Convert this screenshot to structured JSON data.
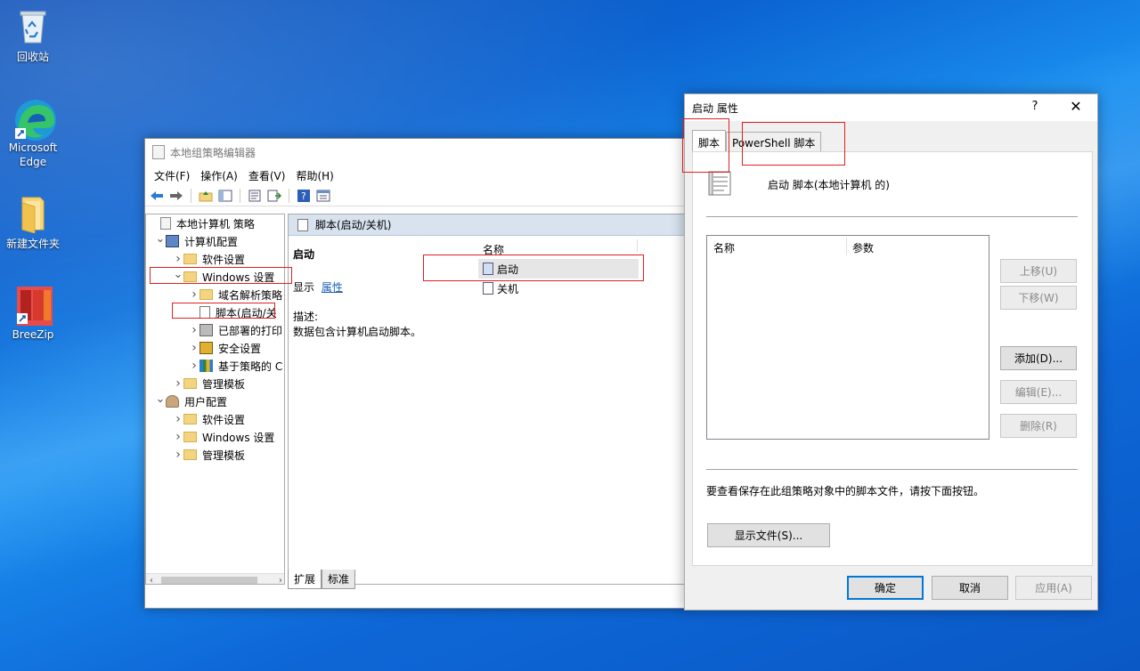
{
  "desktop": {
    "icons": [
      {
        "label": "回收站",
        "icon": "recycle-bin-icon"
      },
      {
        "label": "Microsoft Edge",
        "icon": "edge-icon"
      },
      {
        "label": "新建文件夹",
        "icon": "folder-icon"
      },
      {
        "label": "BreeZip",
        "icon": "breezip-icon"
      }
    ]
  },
  "gp_editor": {
    "title": "本地组策略编辑器",
    "menu": [
      "文件(F)",
      "操作(A)",
      "查看(V)",
      "帮助(H)"
    ],
    "tree": [
      {
        "label": "本地计算机 策略",
        "level": 0,
        "arrow": "",
        "icon": "policy-icon"
      },
      {
        "label": "计算机配置",
        "level": 1,
        "arrow": "down",
        "icon": "computer-icon"
      },
      {
        "label": "软件设置",
        "level": 2,
        "arrow": "right",
        "icon": "folder-icon"
      },
      {
        "label": "Windows 设置",
        "level": 2,
        "arrow": "down",
        "icon": "folder-icon"
      },
      {
        "label": "域名解析策略",
        "level": 3,
        "arrow": "right",
        "icon": "folder-icon"
      },
      {
        "label": "脚本(启动/关",
        "level": 3,
        "arrow": "",
        "icon": "script-icon"
      },
      {
        "label": "已部署的打印",
        "level": 3,
        "arrow": "right",
        "icon": "printer-icon"
      },
      {
        "label": "安全设置",
        "level": 3,
        "arrow": "right",
        "icon": "security-icon"
      },
      {
        "label": "基于策略的 C",
        "level": 3,
        "arrow": "right",
        "icon": "chart-icon"
      },
      {
        "label": "管理模板",
        "level": 2,
        "arrow": "right",
        "icon": "folder-icon"
      },
      {
        "label": "用户配置",
        "level": 1,
        "arrow": "down",
        "icon": "user-icon"
      },
      {
        "label": "软件设置",
        "level": 2,
        "arrow": "right",
        "icon": "folder-icon"
      },
      {
        "label": "Windows 设置",
        "level": 2,
        "arrow": "right",
        "icon": "folder-icon"
      },
      {
        "label": "管理模板",
        "level": 2,
        "arrow": "right",
        "icon": "folder-icon"
      }
    ],
    "detail": {
      "header": "脚本(启动/关机)",
      "section_title": "启动",
      "show_label": "显示",
      "properties_link": "属性",
      "desc_label": "描述:",
      "desc_text": "数据包含计算机启动脚本。",
      "column_name": "名称",
      "items": [
        "启动",
        "关机"
      ]
    },
    "tabs": [
      "扩展",
      "标准"
    ]
  },
  "dialog": {
    "title": "启动 属性",
    "help": "?",
    "close": "✕",
    "tabs": [
      "脚本",
      "PowerShell 脚本"
    ],
    "heading": "启动 脚本(本地计算机 的)",
    "list_columns": [
      "名称",
      "参数"
    ],
    "buttons": {
      "up": "上移(U)",
      "down": "下移(W)",
      "add": "添加(D)...",
      "edit": "编辑(E)...",
      "remove": "删除(R)"
    },
    "hint": "要查看保存在此组策略对象中的脚本文件，请按下面按钮。",
    "show_files": "显示文件(S)...",
    "ok": "确定",
    "cancel": "取消",
    "apply": "应用(A)"
  }
}
